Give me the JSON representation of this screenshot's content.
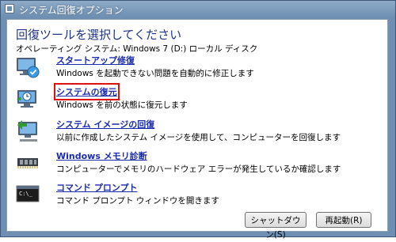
{
  "window": {
    "title": "システム回復オプション"
  },
  "header": {
    "heading": "回復ツールを選択してください",
    "subheading": "オペレーティング システム: Windows 7 (D:) ローカル ディスク"
  },
  "options": [
    {
      "label": "スタートアップ修復",
      "description": "Windows を起動できない問題を自動的に修正します",
      "icon": "startup-repair-icon"
    },
    {
      "label": "システムの復元",
      "description": "Windows を前の状態に復元します",
      "icon": "system-restore-icon"
    },
    {
      "label": "システム イメージの回復",
      "description": "以前に作成したシステム イメージを使用して、コンピューターを回復します",
      "icon": "system-image-icon"
    },
    {
      "label": "Windows メモリ診断",
      "description": "コンピューターでメモリのハードウェア エラーが発生しているか確認します",
      "icon": "memory-chip-icon"
    },
    {
      "label": "コマンド プロンプト",
      "description": "コマンド プロンプト ウィンドウを開きます",
      "icon": "command-prompt-icon"
    }
  ],
  "buttons": {
    "shutdown": "シャットダウン(S)",
    "restart": "再起動(R)"
  },
  "colors": {
    "link": "#1a2bb0",
    "heading": "#1e3287",
    "titlebar": "#6d8eb0",
    "highlight": "#e01010"
  }
}
